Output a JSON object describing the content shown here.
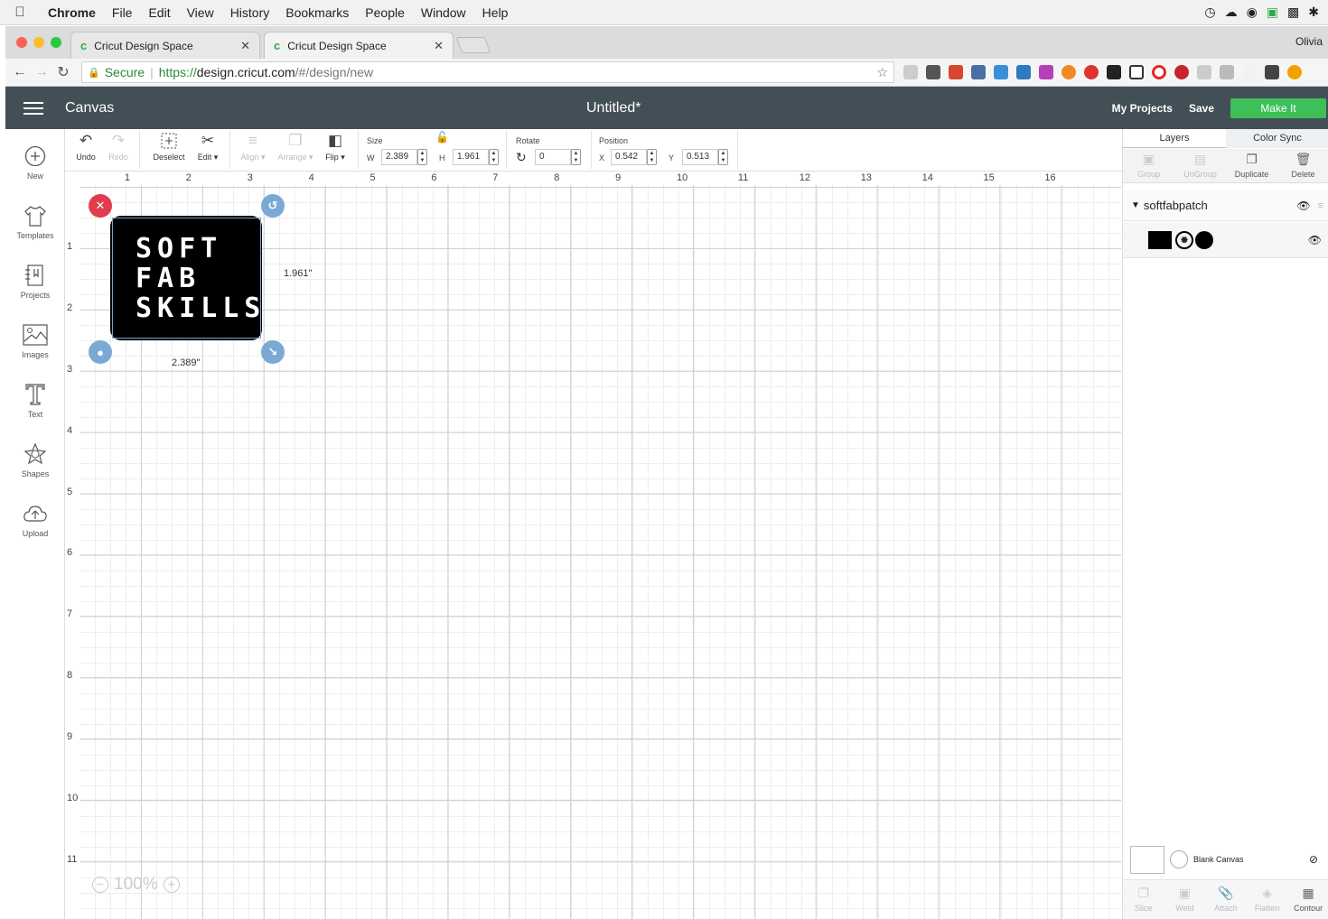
{
  "menubar": {
    "app": "Chrome",
    "items": [
      "File",
      "Edit",
      "View",
      "History",
      "Bookmarks",
      "People",
      "Window",
      "Help"
    ]
  },
  "browser": {
    "tabs": [
      {
        "title": "Cricut Design Space"
      },
      {
        "title": "Cricut Design Space"
      }
    ],
    "profile": "Olivia",
    "secure_label": "Secure",
    "url_scheme": "https://",
    "url_host": "design.cricut.com",
    "url_path": "/#/design/new"
  },
  "header": {
    "menu_label": "Canvas",
    "title": "Untitled*",
    "my_projects": "My Projects",
    "save": "Save",
    "make_it": "Make It"
  },
  "sidebar": {
    "items": [
      {
        "label": "New",
        "icon": "plus-circle-icon"
      },
      {
        "label": "Templates",
        "icon": "tshirt-icon"
      },
      {
        "label": "Projects",
        "icon": "projects-icon"
      },
      {
        "label": "Images",
        "icon": "image-icon"
      },
      {
        "label": "Text",
        "icon": "text-icon"
      },
      {
        "label": "Shapes",
        "icon": "shapes-icon"
      },
      {
        "label": "Upload",
        "icon": "cloud-upload-icon"
      }
    ]
  },
  "toolbar": {
    "undo": "Undo",
    "redo": "Redo",
    "deselect": "Deselect",
    "edit": "Edit",
    "align": "Align",
    "arrange": "Arrange",
    "flip": "Flip",
    "size_label": "Size",
    "w_label": "W",
    "w_value": "2.389",
    "h_label": "H",
    "h_value": "1.961",
    "rotate_label": "Rotate",
    "rotate_value": "0",
    "position_label": "Position",
    "x_label": "X",
    "x_value": "0.542",
    "y_label": "Y",
    "y_value": "0.513"
  },
  "rulers": {
    "horizontal": [
      "1",
      "2",
      "3",
      "4",
      "5",
      "6",
      "7",
      "8",
      "9",
      "10",
      "11",
      "12",
      "13",
      "14",
      "15",
      "16"
    ],
    "vertical": [
      "1",
      "2",
      "3",
      "4",
      "5",
      "6",
      "7",
      "8",
      "9",
      "10",
      "11"
    ]
  },
  "design": {
    "line1": "SOFT",
    "line2": "FAB",
    "line3": "SKILLS",
    "height_label": "1.961\"",
    "width_label": "2.389\""
  },
  "zoom": {
    "level": "100%"
  },
  "layers_panel": {
    "tab_layers": "Layers",
    "tab_color_sync": "Color Sync",
    "actions": [
      "Group",
      "UnGroup",
      "Duplicate",
      "Delete"
    ],
    "group_name": "softfabpatch",
    "blank_canvas": "Blank Canvas",
    "bottom_actions": [
      "Slice",
      "Weld",
      "Attach",
      "Flatten",
      "Contour"
    ]
  },
  "colors": {
    "header_bg": "#434f56",
    "make_it": "#3dbf5a",
    "delete_handle": "#e03c4c",
    "handle_blue": "#7aa9d6"
  }
}
